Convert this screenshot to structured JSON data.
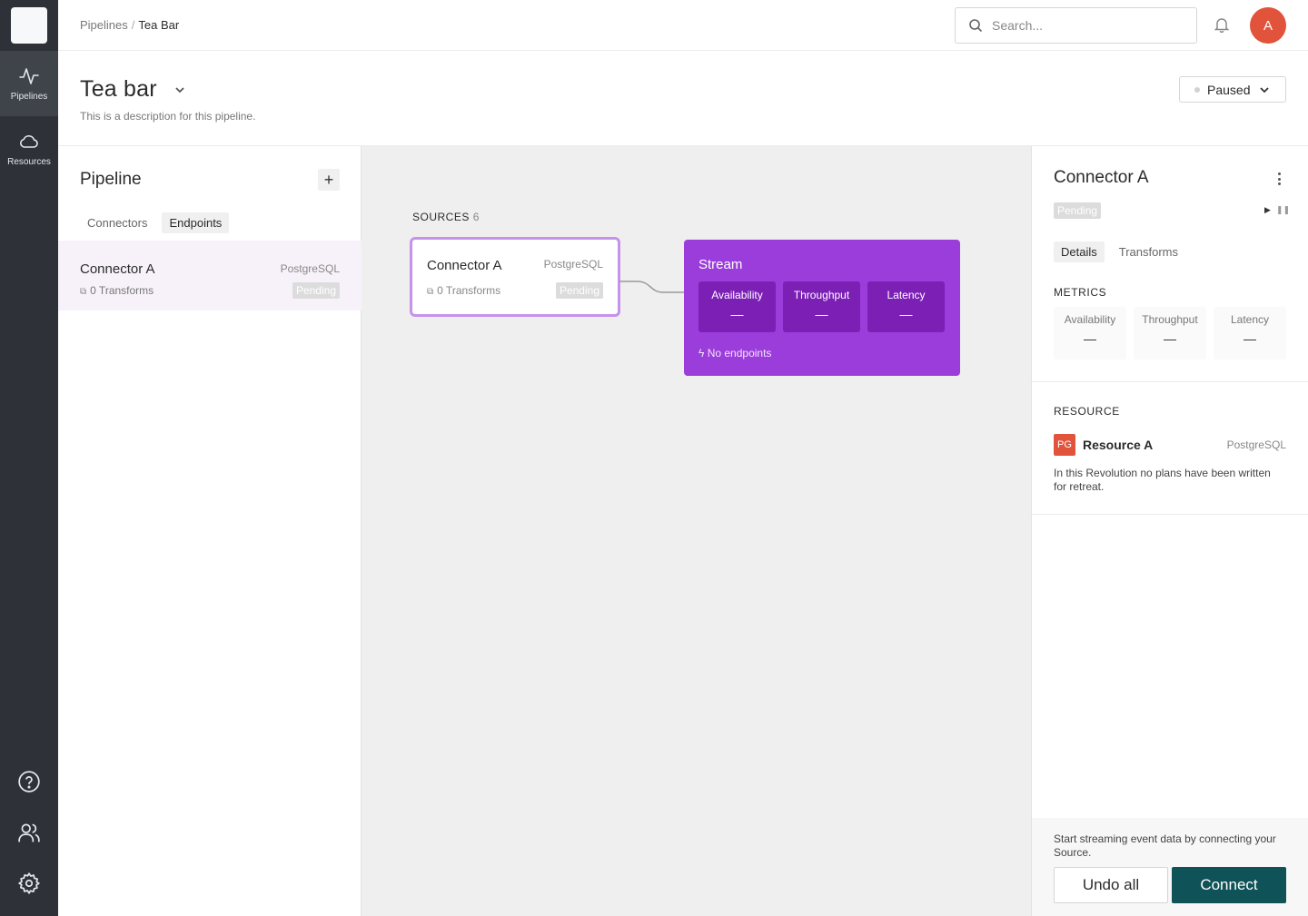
{
  "nav": {
    "items": [
      {
        "label": "Pipelines",
        "icon": "activity-icon"
      },
      {
        "label": "Resources",
        "icon": "cloud-icon"
      }
    ],
    "bottom_icons": [
      "help-icon",
      "users-icon",
      "gear-icon"
    ]
  },
  "topbar": {
    "breadcrumb": [
      "Pipelines",
      "Tea Bar"
    ],
    "search_placeholder": "Search...",
    "avatar_initial": "A"
  },
  "header": {
    "title": "Tea bar",
    "description": "This is a description for this pipeline.",
    "status": "Paused"
  },
  "pipeline_panel": {
    "title": "Pipeline",
    "add_label": "+",
    "tabs": [
      "Connectors",
      "Endpoints"
    ],
    "items": [
      {
        "name": "Connector A",
        "type": "PostgreSQL",
        "transforms": "0 Transforms",
        "status": "Pending"
      }
    ]
  },
  "canvas": {
    "sources_label": "SOURCES",
    "sources_count": "6",
    "node": {
      "name": "Connector A",
      "type": "PostgreSQL",
      "transforms": "0 Transforms",
      "status": "Pending"
    },
    "stream": {
      "title": "Stream",
      "metrics": [
        {
          "label": "Availability",
          "value": "—"
        },
        {
          "label": "Throughput",
          "value": "—"
        },
        {
          "label": "Latency",
          "value": "—"
        }
      ],
      "endpoints_text": "No endpoints"
    }
  },
  "detail_panel": {
    "title": "Connector A",
    "status": "Pending",
    "tabs": [
      "Details",
      "Transforms"
    ],
    "metrics_label": "METRICS",
    "metrics": [
      {
        "label": "Availability",
        "value": "—"
      },
      {
        "label": "Throughput",
        "value": "—"
      },
      {
        "label": "Latency",
        "value": "—"
      }
    ],
    "resource_label": "RESOURCE",
    "resource": {
      "icon_text": "PG",
      "name": "Resource A",
      "type": "PostgreSQL",
      "description": "In this Revolution no plans have been written for retreat."
    },
    "footer_text": "Start streaming event data by connecting your Source.",
    "undo_label": "Undo all",
    "connect_label": "Connect"
  },
  "colors": {
    "rail": "#2e3238",
    "accent_purple": "#9b3ddb",
    "metric_purple": "#7b1fb5",
    "node_border": "#c592ec",
    "connect_button": "#0f5257",
    "avatar": "#e2533c"
  }
}
